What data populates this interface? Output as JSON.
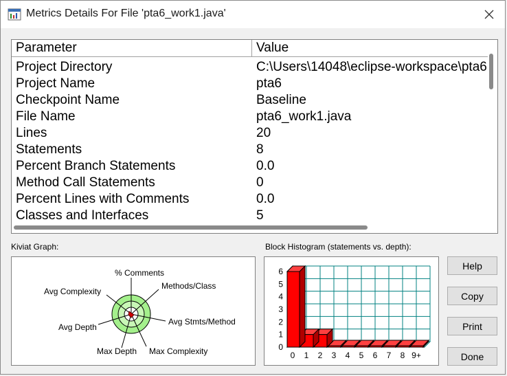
{
  "window": {
    "title": "Metrics Details For File 'pta6_work1.java'"
  },
  "table": {
    "headers": [
      "Parameter",
      "Value"
    ],
    "rows": [
      {
        "param": "Project Directory",
        "value": "C:\\Users\\14048\\eclipse-workspace\\pta6"
      },
      {
        "param": "Project Name",
        "value": "pta6"
      },
      {
        "param": "Checkpoint Name",
        "value": "Baseline"
      },
      {
        "param": "File Name",
        "value": "pta6_work1.java"
      },
      {
        "param": "Lines",
        "value": "20"
      },
      {
        "param": "Statements",
        "value": "8"
      },
      {
        "param": "Percent Branch Statements",
        "value": "0.0"
      },
      {
        "param": "Method Call Statements",
        "value": "0"
      },
      {
        "param": "Percent Lines with Comments",
        "value": "0.0"
      },
      {
        "param": "Classes and Interfaces",
        "value": "5"
      }
    ]
  },
  "kiviat": {
    "label": "Kiviat Graph:",
    "axes": [
      "% Comments",
      "Methods/Class",
      "Avg Stmts/Method",
      "Max Complexity",
      "Max Depth",
      "Avg Depth",
      "Avg Complexity"
    ]
  },
  "histogram": {
    "label": "Block Histogram (statements vs. depth):",
    "colors": {
      "bar": "#ff0000",
      "grid": "#008080"
    },
    "chart_data": {
      "type": "bar",
      "categories": [
        "0",
        "1",
        "2",
        "3",
        "4",
        "5",
        "6",
        "7",
        "8",
        "9+"
      ],
      "values": [
        6,
        1,
        1,
        0,
        0,
        0,
        0,
        0,
        0,
        0
      ],
      "ylim": [
        0,
        6
      ],
      "y_ticks": [
        "0",
        "1",
        "2",
        "3",
        "4",
        "5",
        "6"
      ],
      "grid": true
    }
  },
  "buttons": {
    "help": "Help",
    "copy": "Copy",
    "print": "Print",
    "done": "Done"
  }
}
